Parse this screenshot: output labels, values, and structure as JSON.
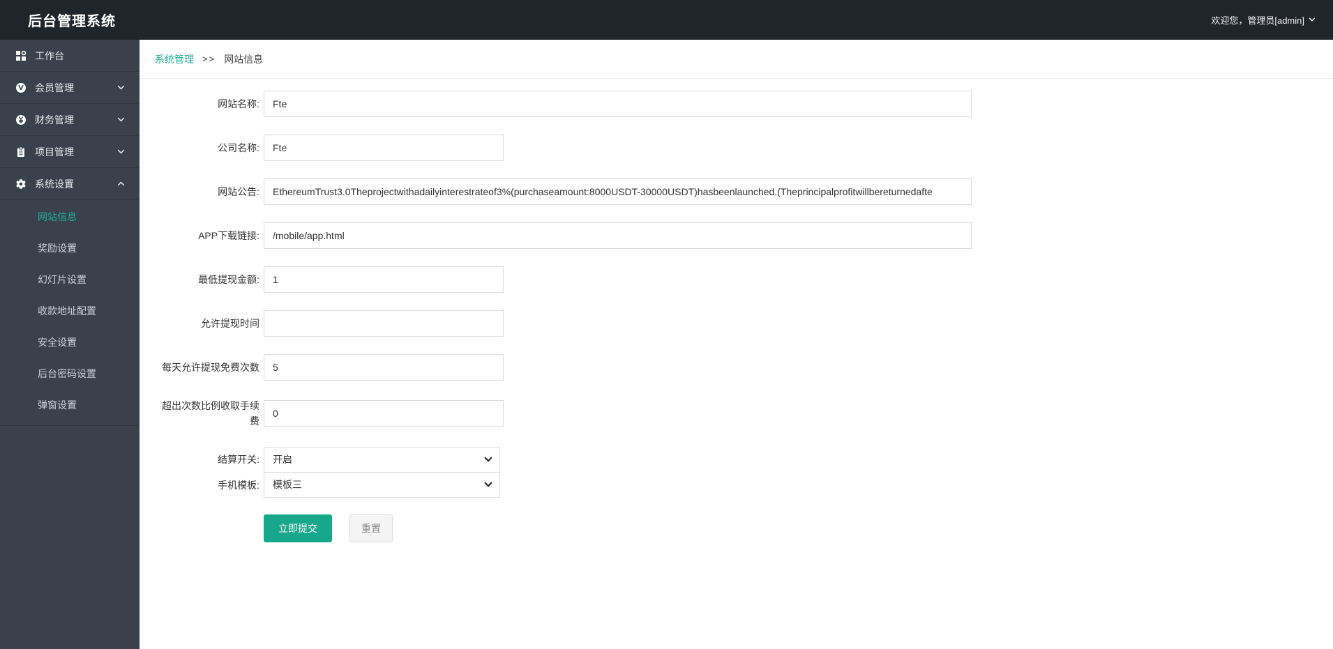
{
  "header": {
    "title": "后台管理系统",
    "welcome": "欢迎您，管理员[admin]"
  },
  "sidebar": {
    "items": [
      {
        "id": "workbench",
        "label": "工作台",
        "icon": "dashboard-grid-icon",
        "expandable": false,
        "expanded": false
      },
      {
        "id": "members",
        "label": "会员管理",
        "icon": "member-icon",
        "expandable": true,
        "expanded": false
      },
      {
        "id": "finance",
        "label": "财务管理",
        "icon": "finance-icon",
        "expandable": true,
        "expanded": false
      },
      {
        "id": "projects",
        "label": "项目管理",
        "icon": "project-icon",
        "expandable": true,
        "expanded": false
      },
      {
        "id": "system",
        "label": "系统设置",
        "icon": "gear-icon",
        "expandable": true,
        "expanded": true
      }
    ],
    "submenu": [
      {
        "id": "site-info",
        "label": "网站信息",
        "active": true
      },
      {
        "id": "reward-settings",
        "label": "奖励设置",
        "active": false
      },
      {
        "id": "slideshow-settings",
        "label": "幻灯片设置",
        "active": false
      },
      {
        "id": "payment-address",
        "label": "收款地址配置",
        "active": false
      },
      {
        "id": "security-settings",
        "label": "安全设置",
        "active": false
      },
      {
        "id": "admin-password",
        "label": "后台密码设置",
        "active": false
      },
      {
        "id": "popup-settings",
        "label": "弹窗设置",
        "active": false
      }
    ]
  },
  "breadcrumb": {
    "parent": "系统管理",
    "separator": ">>",
    "current": "网站信息"
  },
  "form": {
    "fields": [
      {
        "name": "site-name",
        "label": "网站名称:",
        "value": "Fte",
        "size": "wide"
      },
      {
        "name": "company-name",
        "label": "公司名称:",
        "value": "Fte",
        "size": "narrow"
      },
      {
        "name": "site-announcement",
        "label": "网站公告:",
        "value": "EthereumTrust3.0Theprojectwithadailyinterestrateof3%(purchaseamount:8000USDT-30000USDT)hasbeenlaunched.(Theprincipalprofitwillbereturnedafte",
        "size": "wide"
      },
      {
        "name": "app-download-link",
        "label": "APP下载链接:",
        "value": "/mobile/app.html",
        "size": "wide"
      },
      {
        "name": "min-withdraw-amount",
        "label": "最低提现金额:",
        "value": "1",
        "size": "narrow"
      },
      {
        "name": "withdraw-time-allowed",
        "label": "允许提现时间",
        "value": "",
        "size": "narrow"
      },
      {
        "name": "daily-free-withdraw-count",
        "label": "每天允许提现免费次数",
        "value": "5",
        "size": "narrow"
      },
      {
        "name": "excess-fee-ratio",
        "label": "超出次数比例收取手续费",
        "value": "0",
        "size": "narrow"
      }
    ],
    "selects": [
      {
        "name": "settlement-switch",
        "label": "结算开关:",
        "value": "开启"
      },
      {
        "name": "mobile-template",
        "label": "手机模板:",
        "value": "模板三"
      }
    ],
    "submit_label": "立即提交",
    "reset_label": "重置"
  },
  "colors": {
    "topbar_bg": "#20242b",
    "sidebar_bg": "#3a414c",
    "accent_teal": "#1fae96",
    "submit_button": "#17a78a"
  }
}
